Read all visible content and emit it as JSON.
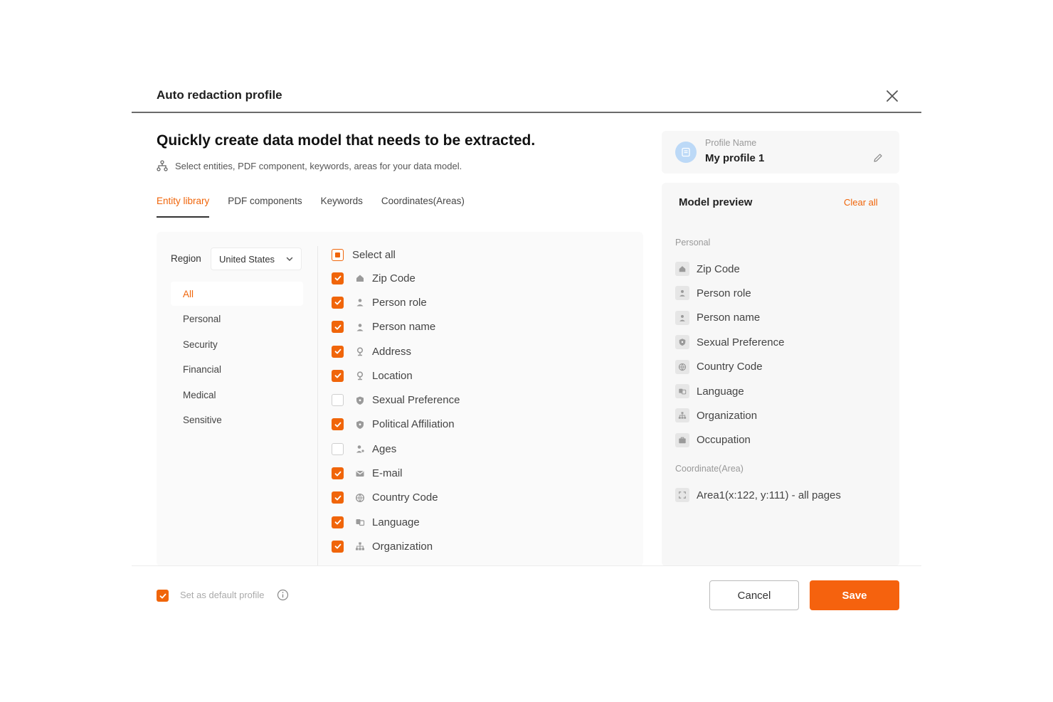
{
  "modal": {
    "title": "Auto redaction profile",
    "headline": "Quickly create data model that needs to be extracted.",
    "subline": "Select entities, PDF component, keywords, areas for your data model."
  },
  "tabs": [
    {
      "label": "Entity library",
      "active": true
    },
    {
      "label": "PDF components",
      "active": false
    },
    {
      "label": "Keywords",
      "active": false
    },
    {
      "label": "Coordinates(Areas)",
      "active": false
    }
  ],
  "region": {
    "label": "Region",
    "value": "United States"
  },
  "categories": [
    "All",
    "Personal",
    "Security",
    "Financial",
    "Medical",
    "Sensitive"
  ],
  "select_all_label": "Select all",
  "entities": [
    {
      "label": "Zip Code",
      "checked": true,
      "icon": "home-icon"
    },
    {
      "label": "Person role",
      "checked": true,
      "icon": "person-icon"
    },
    {
      "label": "Person name",
      "checked": true,
      "icon": "person-icon"
    },
    {
      "label": "Address",
      "checked": true,
      "icon": "pin-icon"
    },
    {
      "label": "Location",
      "checked": true,
      "icon": "pin-icon"
    },
    {
      "label": "Sexual Preference",
      "checked": false,
      "icon": "shield-icon"
    },
    {
      "label": "Political Affiliation",
      "checked": true,
      "icon": "shield-icon"
    },
    {
      "label": "Ages",
      "checked": false,
      "icon": "person-age-icon"
    },
    {
      "label": "E-mail",
      "checked": true,
      "icon": "mail-icon"
    },
    {
      "label": "Country Code",
      "checked": true,
      "icon": "globe-icon"
    },
    {
      "label": "Language",
      "checked": true,
      "icon": "language-icon"
    },
    {
      "label": "Organization",
      "checked": true,
      "icon": "org-icon"
    }
  ],
  "profile": {
    "label": "Profile Name",
    "name": "My profile 1"
  },
  "preview": {
    "title": "Model preview",
    "clear_label": "Clear all",
    "personal_heading": "Personal",
    "personal_items": [
      {
        "label": "Zip Code",
        "icon": "home-icon"
      },
      {
        "label": "Person role",
        "icon": "person-icon"
      },
      {
        "label": "Person name",
        "icon": "person-icon"
      },
      {
        "label": "Sexual Preference",
        "icon": "shield-icon"
      },
      {
        "label": "Country Code",
        "icon": "globe-icon"
      },
      {
        "label": "Language",
        "icon": "language-icon"
      },
      {
        "label": "Organization",
        "icon": "org-icon"
      },
      {
        "label": "Occupation",
        "icon": "briefcase-icon"
      }
    ],
    "coord_heading": "Coordinate(Area)",
    "coord_items": [
      {
        "label": "Area1(x:122, y:111) - all pages",
        "icon": "area-icon"
      }
    ]
  },
  "footer": {
    "default_label": "Set as default profile",
    "default_checked": true,
    "cancel_label": "Cancel",
    "save_label": "Save"
  },
  "colors": {
    "accent": "#f0650a",
    "save": "#f5620e"
  }
}
